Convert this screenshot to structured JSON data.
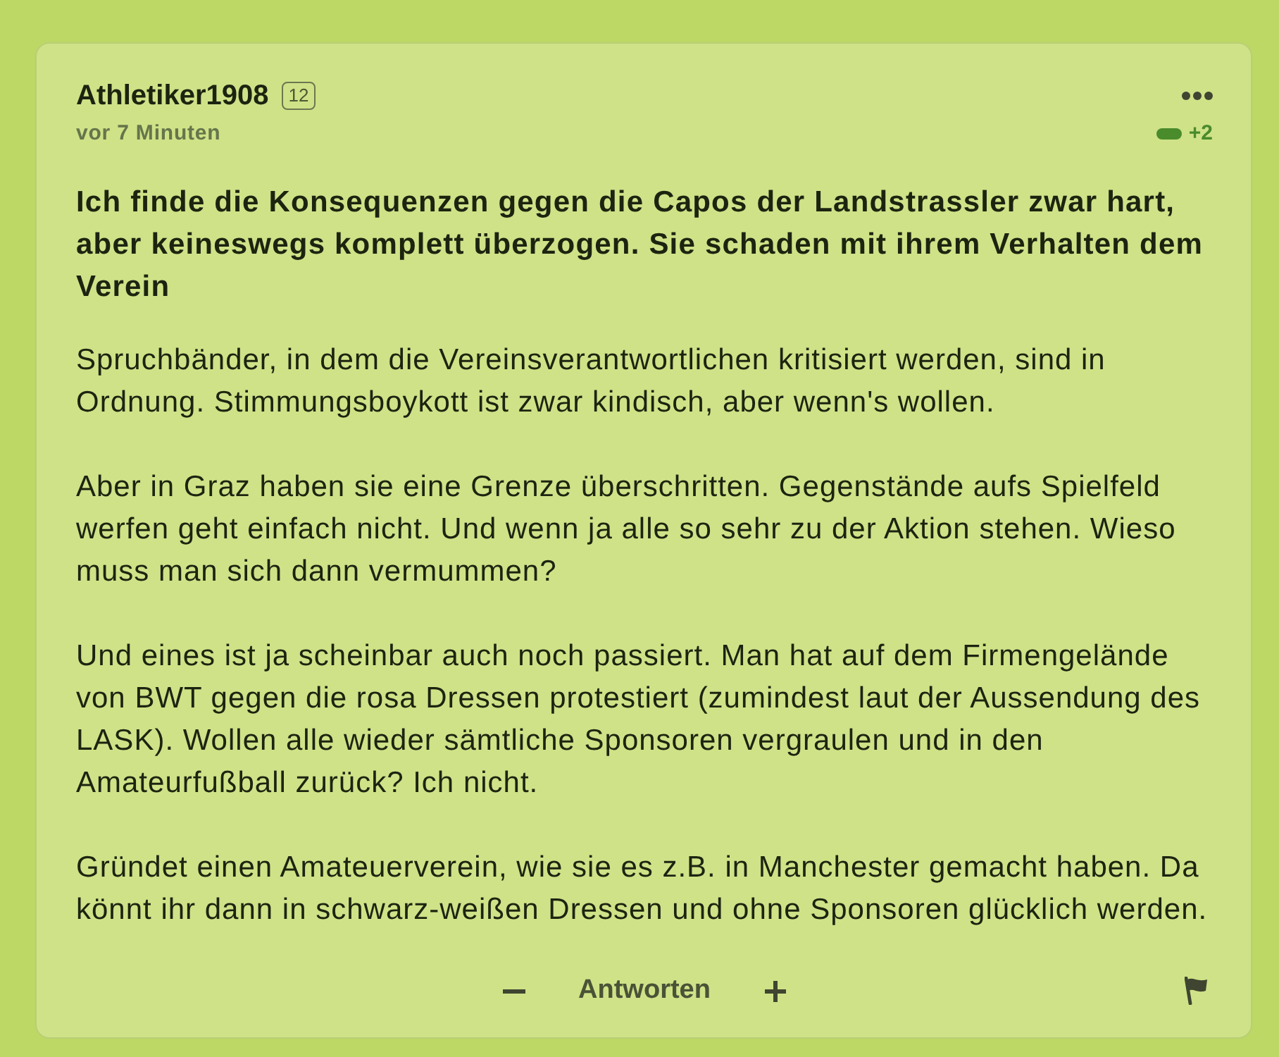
{
  "comment": {
    "author": "Athletiker1908",
    "badge": "12",
    "time": "vor 7 Minuten",
    "rating": "+2",
    "title": "Ich finde die Konsequenzen gegen die Capos der Landstrassler zwar hart, aber keineswegs komplett überzogen. Sie schaden mit ihrem Verhalten dem Verein",
    "paragraphs": [
      "Spruchbänder, in dem die Vereinsverantwortlichen kritisiert werden, sind in Ordnung. Stimmungsboykott ist zwar kindisch, aber wenn's wollen.",
      "Aber in Graz haben sie eine Grenze überschritten. Gegenstände aufs Spielfeld werfen geht einfach nicht. Und wenn ja alle so sehr zu der Aktion stehen. Wieso muss man sich dann vermummen?",
      "Und eines ist ja scheinbar auch noch passiert. Man hat auf dem Firmengelände von BWT gegen die rosa Dressen protestiert (zumindest laut der Aussendung des LASK). Wollen alle wieder sämtliche Sponsoren vergraulen und in den Amateurfußball zurück? Ich nicht.",
      "Gründet einen Amateuerverein, wie sie es z.B. in Manchester gemacht haben. Da könnt ihr dann in schwarz-weißen Dressen und ohne Sponsoren glücklich werden."
    ]
  },
  "actions": {
    "reply": "Antworten"
  }
}
